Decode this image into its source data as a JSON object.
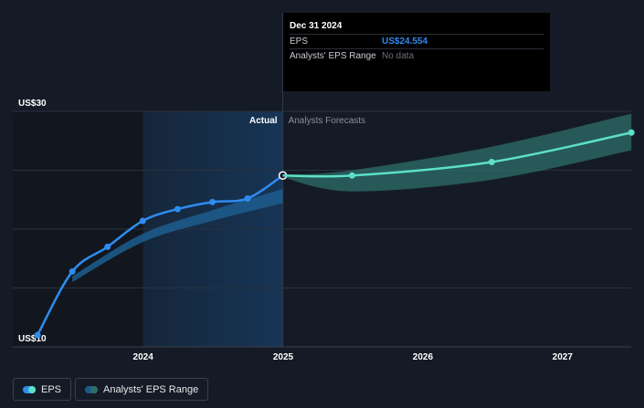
{
  "chart_data": {
    "type": "line",
    "y_axis": {
      "min": 10,
      "max": 30,
      "top_label": "US$30",
      "bottom_label": "US$10",
      "gridlines": [
        30,
        25,
        20,
        15,
        10
      ]
    },
    "x_axis": {
      "ticks": [
        "2024",
        "2025",
        "2026",
        "2027"
      ],
      "range": [
        "2023-01",
        "2027-09"
      ]
    },
    "section_labels": {
      "actual": "Actual",
      "forecast": "Analysts Forecasts"
    },
    "series": [
      {
        "name": "EPS",
        "kind": "actual",
        "color": "#2f8cf0",
        "points": [
          {
            "x": "2023-03-31",
            "y": 11.0
          },
          {
            "x": "2023-06-30",
            "y": 16.4
          },
          {
            "x": "2023-09-30",
            "y": 18.5
          },
          {
            "x": "2023-12-31",
            "y": 20.7
          },
          {
            "x": "2024-03-31",
            "y": 21.7
          },
          {
            "x": "2024-06-30",
            "y": 22.3
          },
          {
            "x": "2024-09-30",
            "y": 22.6
          },
          {
            "x": "2024-12-31",
            "y": 24.554
          }
        ]
      },
      {
        "name": "EPS",
        "kind": "forecast",
        "color": "#5de0c8",
        "points": [
          {
            "x": "2024-12-31",
            "y": 24.554
          },
          {
            "x": "2025-06-30",
            "y": 24.55
          },
          {
            "x": "2026-06-30",
            "y": 25.7
          },
          {
            "x": "2027-06-30",
            "y": 28.2
          }
        ]
      }
    ],
    "ranges": [
      {
        "name": "Analysts' EPS Range",
        "kind": "actual",
        "color": "#1d5a8a",
        "band": [
          {
            "x": "2023-06-30",
            "low": 15.5,
            "high": 16.0
          },
          {
            "x": "2023-12-31",
            "low": 18.9,
            "high": 19.6
          },
          {
            "x": "2024-06-30",
            "low": 20.7,
            "high": 21.6
          },
          {
            "x": "2024-12-31",
            "low": 22.2,
            "high": 23.4
          }
        ]
      },
      {
        "name": "Analysts' EPS Range",
        "kind": "forecast",
        "color": "#2e6f6a",
        "band": [
          {
            "x": "2024-12-31",
            "low": 24.4,
            "high": 24.6
          },
          {
            "x": "2025-06-30",
            "low": 23.2,
            "high": 25.0
          },
          {
            "x": "2026-06-30",
            "low": 24.2,
            "high": 27.0
          },
          {
            "x": "2027-06-30",
            "low": 26.7,
            "high": 29.8
          }
        ]
      }
    ]
  },
  "tooltip": {
    "date": "Dec 31 2024",
    "rows": [
      {
        "label": "EPS",
        "value": "US$24.554"
      },
      {
        "label": "Analysts' EPS Range",
        "value": "No data"
      }
    ]
  },
  "legend": {
    "items": [
      {
        "label": "EPS"
      },
      {
        "label": "Analysts' EPS Range"
      }
    ]
  }
}
